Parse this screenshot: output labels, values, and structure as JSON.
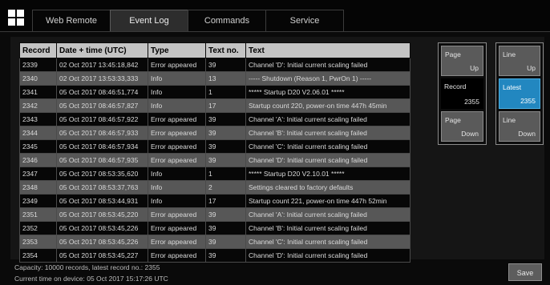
{
  "tabs": [
    "Web Remote",
    "Event Log",
    "Commands",
    "Service"
  ],
  "active_tab": "Event Log",
  "table": {
    "headers": [
      "Record",
      "Date + time (UTC)",
      "Type",
      "Text no.",
      "Text"
    ],
    "rows": [
      [
        "2339",
        "02 Oct 2017 13:45:18,842",
        "Error appeared",
        "39",
        "Channel 'D': Initial current scaling failed"
      ],
      [
        "2340",
        "02 Oct 2017 13:53:33,333",
        "Info",
        "13",
        "----- Shutdown (Reason 1, PwrOn 1) -----"
      ],
      [
        "2341",
        "05 Oct 2017 08:46:51,774",
        "Info",
        "1",
        "***** Startup D20 V2.06.01 *****"
      ],
      [
        "2342",
        "05 Oct 2017 08:46:57,827",
        "Info",
        "17",
        "Startup count 220, power-on time 447h 45min"
      ],
      [
        "2343",
        "05 Oct 2017 08:46:57,922",
        "Error appeared",
        "39",
        "Channel 'A': Initial current scaling failed"
      ],
      [
        "2344",
        "05 Oct 2017 08:46:57,933",
        "Error appeared",
        "39",
        "Channel 'B': Initial current scaling failed"
      ],
      [
        "2345",
        "05 Oct 2017 08:46:57,934",
        "Error appeared",
        "39",
        "Channel 'C': Initial current scaling failed"
      ],
      [
        "2346",
        "05 Oct 2017 08:46:57,935",
        "Error appeared",
        "39",
        "Channel 'D': Initial current scaling failed"
      ],
      [
        "2347",
        "05 Oct 2017 08:53:35,620",
        "Info",
        "1",
        "***** Startup D20 V2.10.01 *****"
      ],
      [
        "2348",
        "05 Oct 2017 08:53:37,763",
        "Info",
        "2",
        "Settings cleared to factory defaults"
      ],
      [
        "2349",
        "05 Oct 2017 08:53:44,931",
        "Info",
        "17",
        "Startup count 221, power-on time 447h 52min"
      ],
      [
        "2351",
        "05 Oct 2017 08:53:45,220",
        "Error appeared",
        "39",
        "Channel 'A': Initial current scaling failed"
      ],
      [
        "2352",
        "05 Oct 2017 08:53:45,226",
        "Error appeared",
        "39",
        "Channel 'B': Initial current scaling failed"
      ],
      [
        "2353",
        "05 Oct 2017 08:53:45,226",
        "Error appeared",
        "39",
        "Channel 'C': Initial current scaling failed"
      ],
      [
        "2354",
        "05 Oct 2017 08:53:45,227",
        "Error appeared",
        "39",
        "Channel 'D': Initial current scaling failed"
      ]
    ]
  },
  "nav": {
    "page_up": [
      "Page",
      "Up"
    ],
    "record": [
      "Record",
      "2355"
    ],
    "page_down": [
      "Page",
      "Down"
    ],
    "line_up": [
      "Line",
      "Up"
    ],
    "latest": [
      "Latest",
      "2355"
    ],
    "line_down": [
      "Line",
      "Down"
    ]
  },
  "status": {
    "capacity": "Capacity: 10000 records, latest record no.: 2355",
    "current_time": "Current time on device: 05 Oct 2017 15:17:26 UTC"
  },
  "save_label": "Save",
  "colors": {
    "selected_button": "#2287c0",
    "header_bg": "#c4c4c4",
    "row_alt_bg": "#575757"
  },
  "icons": {
    "logo": "four-squares-logo-icon"
  }
}
